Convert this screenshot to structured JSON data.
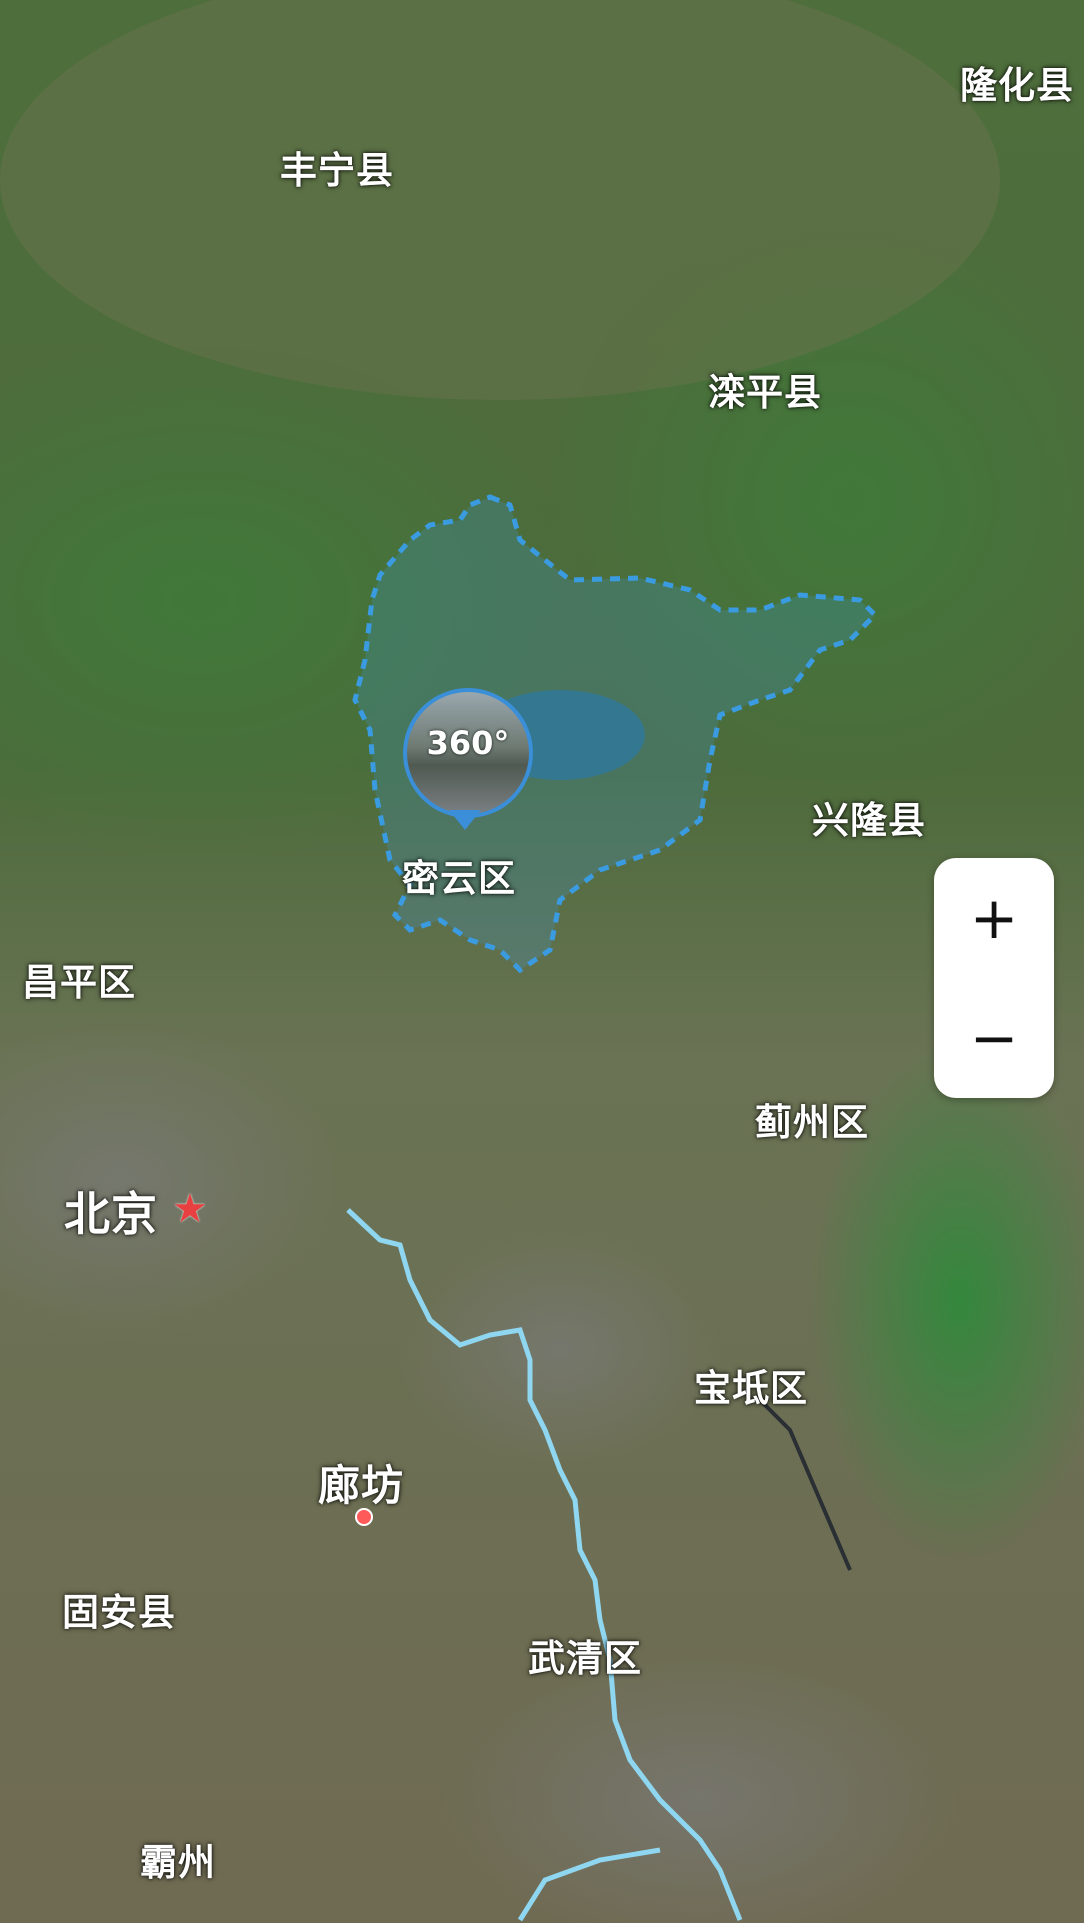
{
  "map": {
    "labels": {
      "longhua": "隆化县",
      "fengning": "丰宁县",
      "luanping": "滦平县",
      "xinglong": "兴隆县",
      "miyun": "密云区",
      "changping": "昌平区",
      "jizhou": "蓟州区",
      "beijing": "北京",
      "baodi": "宝坻区",
      "langfang": "廊坊",
      "guan": "固安县",
      "wuqing": "武清区",
      "bazhou": "霸州"
    },
    "pin": {
      "text": "360°",
      "icon": "panorama-360-icon"
    },
    "capital_marker": {
      "icon": "star-icon",
      "glyph": "★",
      "color": "#e84040"
    },
    "city_marker": {
      "icon": "dot-icon",
      "color": "#ff5a5a"
    },
    "highlight_color": "#3a9be0",
    "river_color": "#8fd6f0"
  },
  "zoom": {
    "in_label": "+",
    "out_label": "−"
  }
}
